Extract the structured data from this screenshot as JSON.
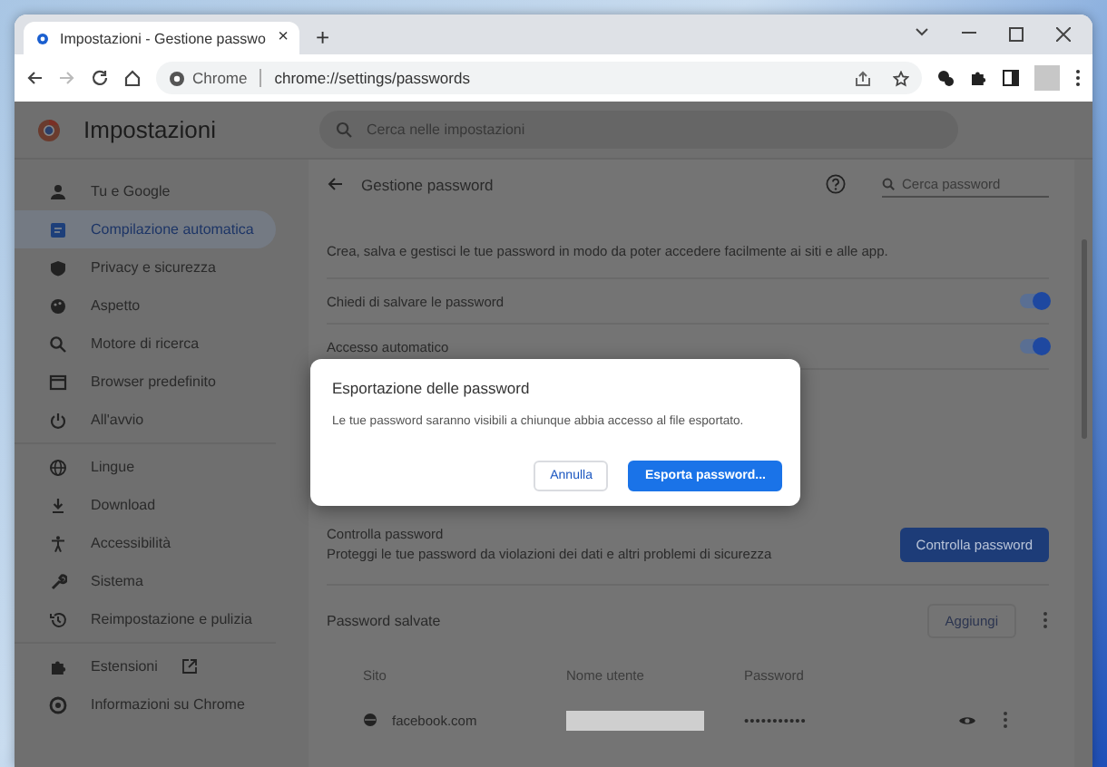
{
  "browser": {
    "tab": {
      "title": "Impostazioni - Gestione passwo",
      "close": "×"
    },
    "new_tab": "+",
    "address": {
      "site_label": "Chrome",
      "url": "chrome://settings/passwords"
    }
  },
  "header": {
    "title": "Impostazioni",
    "search": {
      "placeholder": "Cerca nelle impostazioni"
    }
  },
  "sidebar": {
    "groups": [
      [
        {
          "label": "Tu e Google",
          "selected": false,
          "external": false
        },
        {
          "label": "Compilazione automatica",
          "selected": true,
          "external": false
        },
        {
          "label": "Privacy e sicurezza",
          "selected": false,
          "external": false
        },
        {
          "label": "Aspetto",
          "selected": false,
          "external": false
        },
        {
          "label": "Motore di ricerca",
          "selected": false,
          "external": false
        },
        {
          "label": "Browser predefinito",
          "selected": false,
          "external": false
        },
        {
          "label": "All'avvio",
          "selected": false,
          "external": false
        }
      ],
      [
        {
          "label": "Lingue",
          "selected": false,
          "external": false
        },
        {
          "label": "Download",
          "selected": false,
          "external": false
        },
        {
          "label": "Accessibilità",
          "selected": false,
          "external": false
        },
        {
          "label": "Sistema",
          "selected": false,
          "external": false
        },
        {
          "label": "Reimpostazione e pulizia",
          "selected": false,
          "external": false
        }
      ],
      [
        {
          "label": "Estensioni",
          "selected": false,
          "external": true
        },
        {
          "label": "Informazioni su Chrome",
          "selected": false,
          "external": false
        }
      ]
    ]
  },
  "main": {
    "title": "Gestione password",
    "search": {
      "placeholder": "Cerca password"
    },
    "intro": "Crea, salva e gestisci le tue password in modo da poter accedere facilmente ai siti e alle app.",
    "settings": [
      {
        "label": "Chiedi di salvare le password",
        "on": true
      },
      {
        "label": "Accesso automatico",
        "on": true
      }
    ],
    "check": {
      "title": "Controlla password",
      "description": "Proteggi le tue password da violazioni dei dati e altri problemi di sicurezza",
      "button": "Controlla password"
    },
    "saved": {
      "title": "Password salvate",
      "add_button": "Aggiungi",
      "columns": [
        "Sito",
        "Nome utente",
        "Password"
      ],
      "rows": [
        {
          "site": "facebook.com",
          "password": "•••••••••••"
        }
      ]
    }
  },
  "dialog": {
    "title": "Esportazione delle password",
    "message": "Le tue password saranno visibili a chiunque abbia accesso al file esportato.",
    "cancel": "Annulla",
    "confirm": "Esporta password..."
  }
}
